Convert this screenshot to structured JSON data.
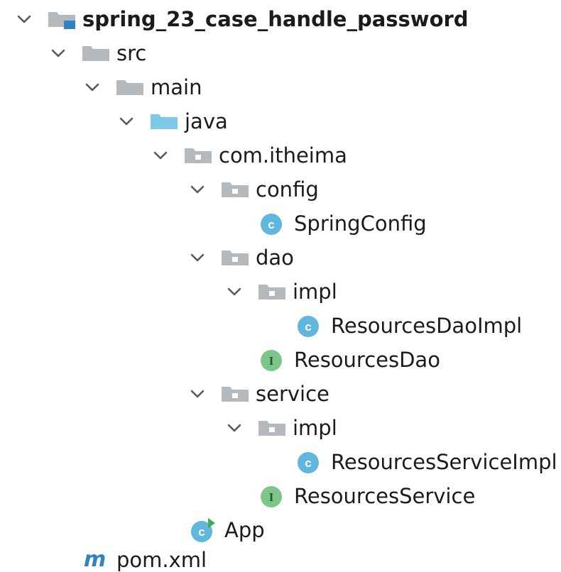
{
  "project_tree": {
    "root": {
      "label": "spring_23_case_handle_password",
      "icon": "project-folder-icon",
      "expanded": true
    },
    "nodes": [
      {
        "label": "src",
        "icon": "folder-icon",
        "expanded": true
      },
      {
        "label": "main",
        "icon": "folder-icon",
        "expanded": true
      },
      {
        "label": "java",
        "icon": "source-root-folder-icon",
        "expanded": true
      },
      {
        "label": "com.itheima",
        "icon": "package-icon",
        "expanded": true
      },
      {
        "label": "config",
        "icon": "package-icon",
        "expanded": true
      },
      {
        "label": "SpringConfig",
        "icon": "class-icon"
      },
      {
        "label": "dao",
        "icon": "package-icon",
        "expanded": true
      },
      {
        "label": "impl",
        "icon": "package-icon",
        "expanded": true
      },
      {
        "label": "ResourcesDaoImpl",
        "icon": "class-icon"
      },
      {
        "label": "ResourcesDao",
        "icon": "interface-icon"
      },
      {
        "label": "service",
        "icon": "package-icon",
        "expanded": true
      },
      {
        "label": "impl",
        "icon": "package-icon",
        "expanded": true
      },
      {
        "label": "ResourcesServiceImpl",
        "icon": "class-icon"
      },
      {
        "label": "ResourcesService",
        "icon": "interface-icon"
      },
      {
        "label": "App",
        "icon": "runnable-class-icon"
      },
      {
        "label": "pom.xml",
        "icon": "maven-icon"
      }
    ]
  },
  "colors": {
    "folder": "#b4b9bd",
    "source_folder": "#7ec8ea",
    "class": "#5fb6de",
    "interface": "#7cc487",
    "maven": "#2f83c5",
    "run_arrow": "#3cae4b",
    "chevron": "#5a5a5a"
  }
}
